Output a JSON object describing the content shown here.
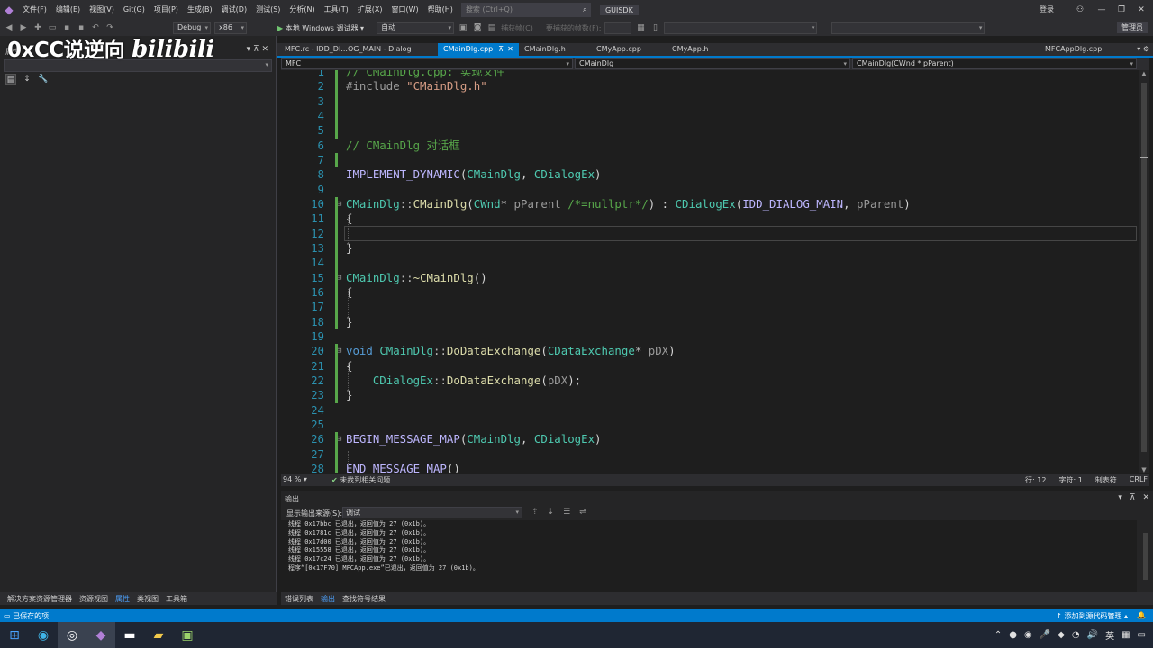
{
  "menubar": {
    "items": [
      "文件(F)",
      "编辑(E)",
      "视图(V)",
      "Git(G)",
      "项目(P)",
      "生成(B)",
      "调试(D)",
      "测试(S)",
      "分析(N)",
      "工具(T)",
      "扩展(X)",
      "窗口(W)",
      "帮助(H)"
    ],
    "search_placeholder": "搜索 (Ctrl+Q)",
    "solution_name": "GUISDK",
    "login": "登录"
  },
  "toolbar": {
    "config": "Debug",
    "platform": "x86",
    "run_label": "本地 Windows 调试器",
    "run_mode": "自动",
    "dim1": "捕获帧(C)",
    "dim2": "要捕获的帧数(F):",
    "admin": "管理员"
  },
  "left_panel": {
    "title": "属性",
    "tabs": [
      "解决方案资源管理器",
      "资源视图",
      "属性",
      "类视图",
      "工具箱"
    ],
    "active_tab": "属性"
  },
  "watermark": {
    "text": "0xCC说逆向",
    "brand": "bilibili"
  },
  "doc_tabs": [
    {
      "label": "MFC.rc - IDD_DI...OG_MAIN - Dialog",
      "active": false
    },
    {
      "label": "CMainDlg.cpp",
      "active": true
    },
    {
      "label": "CMainDlg.h",
      "active": false
    },
    {
      "label": "CMyApp.cpp",
      "active": false
    },
    {
      "label": "CMyApp.h",
      "active": false
    },
    {
      "label": "MFCAppDlg.cpp",
      "active": false
    }
  ],
  "nav": {
    "project": "MFC",
    "scope": "CMainDlg",
    "member": "CMainDlg(CWnd * pParent)"
  },
  "editor": {
    "lines": [
      {
        "n": "1",
        "segs": [
          [
            "t-com",
            "// CMainDlg.cpp: 实现文件"
          ]
        ]
      },
      {
        "n": "2",
        "segs": [
          [
            "t-pp",
            "#include "
          ],
          [
            "t-str",
            "\"CMainDlg.h\""
          ]
        ]
      },
      {
        "n": "3",
        "segs": []
      },
      {
        "n": "4",
        "segs": []
      },
      {
        "n": "5",
        "segs": []
      },
      {
        "n": "6",
        "segs": [
          [
            "t-com",
            "// CMainDlg 对话框"
          ]
        ]
      },
      {
        "n": "7",
        "segs": []
      },
      {
        "n": "8",
        "segs": [
          [
            "t-mac",
            "IMPLEMENT_DYNAMIC"
          ],
          [
            "t-def",
            "("
          ],
          [
            "t-cls",
            "CMainDlg"
          ],
          [
            "t-def",
            ", "
          ],
          [
            "t-cls",
            "CDialogEx"
          ],
          [
            "t-def",
            ")"
          ]
        ]
      },
      {
        "n": "9",
        "segs": []
      },
      {
        "n": "10",
        "fold": "⊟",
        "segs": [
          [
            "t-cls",
            "CMainDlg"
          ],
          [
            "t-op",
            "::"
          ],
          [
            "t-fn",
            "CMainDlg"
          ],
          [
            "t-def",
            "("
          ],
          [
            "t-cls",
            "CWnd"
          ],
          [
            "t-op",
            "* "
          ],
          [
            "t-par",
            "pParent "
          ],
          [
            "t-com",
            "/*=nullptr*/"
          ],
          [
            "t-def",
            ") : "
          ],
          [
            "t-cls",
            "CDialogEx"
          ],
          [
            "t-def",
            "("
          ],
          [
            "t-mac",
            "IDD_DIALOG_MAIN"
          ],
          [
            "t-def",
            ", "
          ],
          [
            "t-par",
            "pParent"
          ],
          [
            "t-def",
            ")"
          ]
        ]
      },
      {
        "n": "11",
        "segs": [
          [
            "t-def",
            "{"
          ]
        ]
      },
      {
        "n": "12",
        "segs": []
      },
      {
        "n": "13",
        "segs": [
          [
            "t-def",
            "}"
          ]
        ]
      },
      {
        "n": "14",
        "segs": []
      },
      {
        "n": "15",
        "fold": "⊟",
        "segs": [
          [
            "t-cls",
            "CMainDlg"
          ],
          [
            "t-op",
            "::"
          ],
          [
            "t-fn",
            "~CMainDlg"
          ],
          [
            "t-def",
            "()"
          ]
        ]
      },
      {
        "n": "16",
        "segs": [
          [
            "t-def",
            "{"
          ]
        ]
      },
      {
        "n": "17",
        "segs": []
      },
      {
        "n": "18",
        "segs": [
          [
            "t-def",
            "}"
          ]
        ]
      },
      {
        "n": "19",
        "segs": []
      },
      {
        "n": "20",
        "fold": "⊟",
        "segs": [
          [
            "t-kw",
            "void "
          ],
          [
            "t-cls",
            "CMainDlg"
          ],
          [
            "t-op",
            "::"
          ],
          [
            "t-fn",
            "DoDataExchange"
          ],
          [
            "t-def",
            "("
          ],
          [
            "t-cls",
            "CDataExchange"
          ],
          [
            "t-op",
            "* "
          ],
          [
            "t-par",
            "pDX"
          ],
          [
            "t-def",
            ")"
          ]
        ]
      },
      {
        "n": "21",
        "segs": [
          [
            "t-def",
            "{"
          ]
        ]
      },
      {
        "n": "22",
        "segs": [
          [
            "t-def",
            "    "
          ],
          [
            "t-cls",
            "CDialogEx"
          ],
          [
            "t-op",
            "::"
          ],
          [
            "t-fn",
            "DoDataExchange"
          ],
          [
            "t-def",
            "("
          ],
          [
            "t-par",
            "pDX"
          ],
          [
            "t-def",
            ");"
          ]
        ]
      },
      {
        "n": "23",
        "segs": [
          [
            "t-def",
            "}"
          ]
        ]
      },
      {
        "n": "24",
        "segs": []
      },
      {
        "n": "25",
        "segs": []
      },
      {
        "n": "26",
        "fold": "⊟",
        "segs": [
          [
            "t-mac",
            "BEGIN_MESSAGE_MAP"
          ],
          [
            "t-def",
            "("
          ],
          [
            "t-cls",
            "CMainDlg"
          ],
          [
            "t-def",
            ", "
          ],
          [
            "t-cls",
            "CDialogEx"
          ],
          [
            "t-def",
            ")"
          ]
        ]
      },
      {
        "n": "27",
        "segs": []
      },
      {
        "n": "28",
        "segs": [
          [
            "t-mac",
            "END_MESSAGE_MAP"
          ],
          [
            "t-def",
            "()"
          ]
        ]
      }
    ]
  },
  "editor_status": {
    "zoom": "94 %",
    "issues": "未找到相关问题",
    "line": "行: 12",
    "char": "字符: 1",
    "indent": "制表符",
    "eol": "CRLF"
  },
  "output": {
    "title": "输出",
    "source_label": "显示输出来源(S):",
    "source_value": "调试",
    "lines": [
      "线程 0x17bbc 已退出，返回值为 27 (0x1b)。",
      "线程 0x1781c 已退出，返回值为 27 (0x1b)。",
      "线程 0x17d00 已退出，返回值为 27 (0x1b)。",
      "线程 0x15558 已退出，返回值为 27 (0x1b)。",
      "线程 0x17c24 已退出，返回值为 27 (0x1b)。",
      "程序“[0x17F70] MFCApp.exe”已退出，返回值为 27 (0x1b)。"
    ]
  },
  "bottom_tabs": [
    "错误列表",
    "输出",
    "查找符号结果"
  ],
  "bottom_active": "输出",
  "statusbar": {
    "left": "已保存的项",
    "right": "添加到源代码管理",
    "accent": "#007acc"
  },
  "taskbar": {
    "ime": "英"
  }
}
